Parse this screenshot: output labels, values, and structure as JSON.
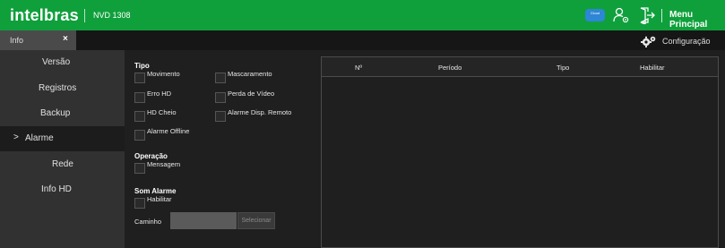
{
  "header": {
    "logo": "intelbras",
    "device_model": "NVD 1308",
    "cloud_badge": "Cloud",
    "main_menu": "Menu Principal"
  },
  "tabs": {
    "info_tab": "Info",
    "close_glyph": "×",
    "config_label": "Configuração"
  },
  "sidebar": {
    "items": [
      {
        "label": "Versão"
      },
      {
        "label": "Registros"
      },
      {
        "label": "Backup"
      },
      {
        "label": "Alarme",
        "active": true
      },
      {
        "label": "Rede"
      },
      {
        "label": "Info HD"
      }
    ],
    "active_marker": ">"
  },
  "form": {
    "tipo": {
      "title": "Tipo",
      "options": [
        "Movimento",
        "Mascaramento",
        "Erro HD",
        "Perda de Vídeo",
        "HD Cheio",
        "Alarme Disp. Remoto",
        "Alarme Offline"
      ]
    },
    "operacao": {
      "title": "Operação",
      "options": [
        "Mensagem"
      ]
    },
    "som_alarme": {
      "title": "Som Alarme",
      "options": [
        "Habilitar"
      ],
      "path_label": "Caminho",
      "path_value": "",
      "select_button": "Selecionar"
    }
  },
  "table": {
    "columns": [
      "Nº",
      "Período",
      "Tipo",
      "Habilitar"
    ],
    "rows": []
  },
  "colors": {
    "brand_green": "#0fa03c",
    "sidebar_bg": "#313131",
    "content_bg": "#1f1f1f"
  },
  "icons": [
    "cloud-icon",
    "user-settings-icon",
    "logout-icon",
    "gears-icon",
    "close-icon"
  ]
}
